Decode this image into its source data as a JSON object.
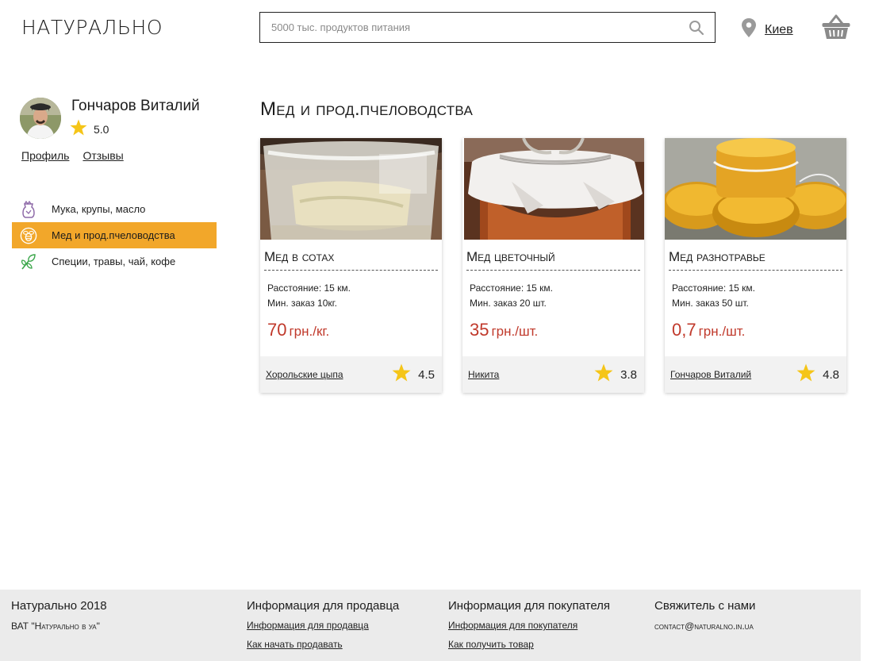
{
  "header": {
    "logo": "НАТУРАЛЬНО",
    "search_placeholder": "5000 тыс. продуктов питания",
    "city": "Киев"
  },
  "profile": {
    "name": "Гончаров Виталий",
    "rating": "5.0",
    "links": {
      "profile": "Профиль",
      "reviews": "Отзывы"
    }
  },
  "categories": [
    {
      "label": "Мука, крупы, масло",
      "icon": "flour-bag-icon"
    },
    {
      "label": "Мед и прод.пчеловодства",
      "icon": "bee-icon",
      "active": true
    },
    {
      "label": "Специи, травы, чай, кофе",
      "icon": "herbs-icon"
    }
  ],
  "page": {
    "title": "Мед и прод.пчеловодства"
  },
  "products": [
    {
      "title": "Мед в сотах",
      "distance": "Расстояние: 15 км.",
      "min_order": "Мин. заказ 10кг.",
      "price": "70",
      "unit": "грн./кг.",
      "seller": "Хорольские цыпа",
      "rating": "4.5"
    },
    {
      "title": "Мед цветочный",
      "distance": "Расстояние: 15 км.",
      "min_order": "Мин. заказ 20 шт.",
      "price": "35",
      "unit": "грн./шт.",
      "seller": "Никита",
      "rating": "3.8"
    },
    {
      "title": "Мед разнотравье",
      "distance": "Расстояние: 15 км.",
      "min_order": "Мин. заказ 50 шт.",
      "price": "0,7",
      "unit": "грн./шт.",
      "seller": "Гончаров Виталий",
      "rating": "4.8"
    }
  ],
  "footer": {
    "brand": "Натурально 2018",
    "company": "ВАТ \"Натурально в уа\"",
    "seller_head": "Информация для продавца",
    "seller_links": [
      "Информация для продавца",
      "Как начать продавать"
    ],
    "buyer_head": "Информация для покупателя",
    "buyer_links": [
      "Информация для покупателя",
      "Как получить товар"
    ],
    "contact_head": "Свяжитель с нами",
    "contact_email": "contact@naturalno.in.ua"
  },
  "colors": {
    "accent": "#f2a72a",
    "price": "#c0392b",
    "star": "#f5c518",
    "footer_bg": "#ebebeb"
  }
}
